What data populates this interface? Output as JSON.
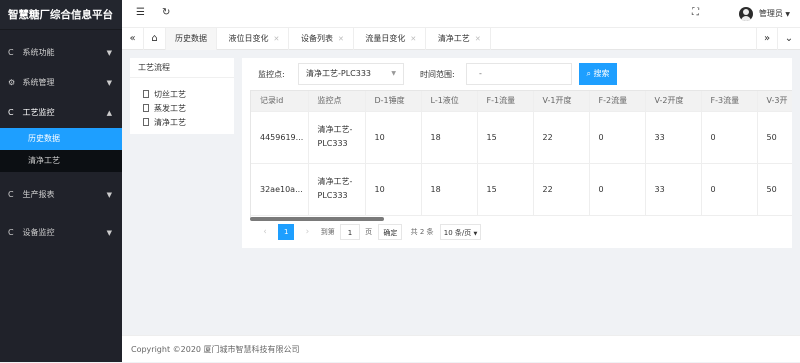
{
  "app": {
    "title": "智慧糖厂综合信息平台"
  },
  "sidebar": {
    "items": [
      {
        "label": "系统功能",
        "icon": "C"
      },
      {
        "label": "系统管理",
        "icon": "⚙"
      },
      {
        "label": "工艺监控",
        "icon": "C"
      },
      {
        "label": "生产报表",
        "icon": "C"
      },
      {
        "label": "设备监控",
        "icon": "C"
      }
    ],
    "submenu": [
      "历史数据",
      "清净工艺"
    ]
  },
  "topbar": {
    "user": "管理员"
  },
  "tabs": [
    {
      "label": "历史数据"
    },
    {
      "label": "液位日变化"
    },
    {
      "label": "设备列表"
    },
    {
      "label": "流量日变化"
    },
    {
      "label": "清净工艺"
    }
  ],
  "tree": {
    "title": "工艺流程",
    "nodes": [
      "切丝工艺",
      "蒸发工艺",
      "清净工艺"
    ]
  },
  "filter": {
    "monitor_label": "监控点:",
    "monitor_value": "清净工艺-PLC333",
    "time_label": "时间范围:",
    "time_value": "-",
    "search_label": "搜索"
  },
  "table": {
    "headers": [
      "记录id",
      "监控点",
      "D-1锤度",
      "L-1液位",
      "F-1流量",
      "V-1开度",
      "F-2流量",
      "V-2开度",
      "F-3流量",
      "V-3开"
    ],
    "rows": [
      [
        "4459619...",
        "清净工艺-PLC333",
        "10",
        "18",
        "15",
        "22",
        "0",
        "33",
        "0",
        "50"
      ],
      [
        "32ae10a...",
        "清净工艺-PLC333",
        "10",
        "18",
        "15",
        "22",
        "0",
        "33",
        "0",
        "50"
      ]
    ]
  },
  "pager": {
    "current": "1",
    "goto_label": "到第",
    "goto_value": "1",
    "page_unit": "页",
    "ok_label": "确定",
    "total": "共 2 条",
    "size": "10 条/页"
  },
  "footer": {
    "text": "Copyright ©2020 厦门城市智慧科技有限公司"
  },
  "colors": {
    "accent": "#1e9fff",
    "sidebar": "#20222a"
  }
}
